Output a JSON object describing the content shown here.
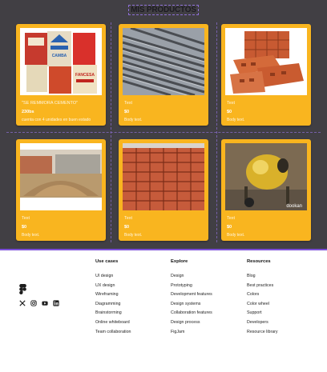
{
  "products": {
    "title": "MIS PRODUCTOS",
    "cards": [
      {
        "title": "\"SE REMMORA CEMENTO\"",
        "price": "230bs",
        "description": "cuenta con 4 unidades en buen estado"
      },
      {
        "title": "Text",
        "price": "$0",
        "description": "Body text."
      },
      {
        "title": "Text",
        "price": "$0",
        "description": "Body text."
      },
      {
        "title": "Text",
        "price": "$0",
        "description": "Body text."
      },
      {
        "title": "Text",
        "price": "$0",
        "description": "Body text."
      },
      {
        "title": "Text",
        "price": "$0",
        "description": "Body text."
      }
    ],
    "images": {
      "c0": {
        "bag1": "CAMBA",
        "bag3": "FANCESA"
      },
      "c5": {
        "watermark": "dookan"
      }
    }
  },
  "footer": {
    "columns": [
      {
        "heading": "Use cases",
        "links": [
          "UI design",
          "UX design",
          "Wireframing",
          "Diagramming",
          "Brainstorming",
          "Online whiteboard",
          "Team collaboration"
        ]
      },
      {
        "heading": "Explore",
        "links": [
          "Design",
          "Prototyping",
          "Development features",
          "Design systems",
          "Collaboration features",
          "Design process",
          "FigJam"
        ]
      },
      {
        "heading": "Resources",
        "links": [
          "Blog",
          "Best practices",
          "Colors",
          "Color wheel",
          "Support",
          "Developers",
          "Resource library"
        ]
      }
    ],
    "brand_icon": "figma-logo-icon",
    "social_icons": [
      "x-twitter-icon",
      "instagram-icon",
      "youtube-icon",
      "linkedin-icon"
    ]
  },
  "colors": {
    "products_bg": "#413f44",
    "card": "#f9b51f",
    "footer_border": "#7b4fd8"
  }
}
